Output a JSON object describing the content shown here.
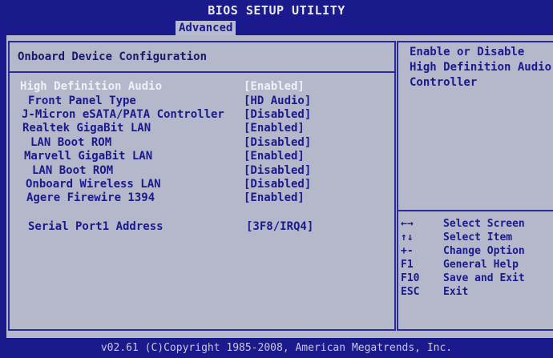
{
  "window": {
    "title": "BIOS SETUP UTILITY"
  },
  "tabs": [
    {
      "label": "Advanced",
      "active": true
    }
  ],
  "section": {
    "title": "Onboard Device Configuration"
  },
  "settings": [
    {
      "label": "High Definition Audio",
      "value": "[Enabled]"
    },
    {
      "label": "Front Panel Type",
      "value": "[HD Audio]"
    },
    {
      "label": "J-Micron eSATA/PATA Controller",
      "value": "[Disabled]"
    },
    {
      "label": "Realtek GigaBit LAN",
      "value": "[Enabled]"
    },
    {
      "label": "LAN Boot ROM",
      "value": "[Disabled]"
    },
    {
      "label": "Marvell GigaBit LAN",
      "value": "[Enabled]"
    },
    {
      "label": "LAN Boot ROM",
      "value": "[Disabled]"
    },
    {
      "label": "Onboard Wireless LAN",
      "value": "[Disabled]"
    },
    {
      "label": "Agere Firewire 1394",
      "value": "[Enabled]"
    },
    {
      "label": "Serial Port1 Address",
      "value": "[3F8/IRQ4]"
    }
  ],
  "help": {
    "text": "Enable or Disable\nHigh Definition Audio\nController"
  },
  "keys": [
    {
      "key": "←→",
      "desc": "Select Screen"
    },
    {
      "key": "↑↓",
      "desc": "Select Item"
    },
    {
      "key": "+-",
      "desc": "Change Option"
    },
    {
      "key": "F1",
      "desc": "General Help"
    },
    {
      "key": "F10",
      "desc": "Save and Exit"
    },
    {
      "key": "ESC",
      "desc": "Exit"
    }
  ],
  "footer": {
    "text": "v02.61 (C)Copyright 1985-2008, American Megatrends, Inc."
  },
  "colors": {
    "background": "#1a1a8c",
    "panel": "#b4b8ca",
    "highlight": "#f0f0f8"
  }
}
